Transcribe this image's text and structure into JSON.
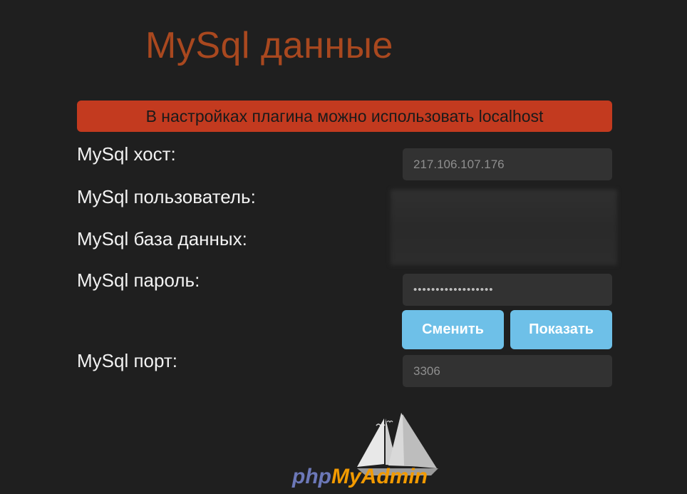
{
  "page": {
    "title": "MySql данные",
    "notice": "В настройках плагина можно использовать localhost"
  },
  "fields": {
    "host": {
      "label": "MySql хост:",
      "value": "217.106.107.176"
    },
    "user": {
      "label": "MySql пользователь:"
    },
    "database": {
      "label": "MySql база данных:"
    },
    "password": {
      "label": "MySql пароль:",
      "value": "••••••••••••••••••"
    },
    "port": {
      "label": "MySql порт:",
      "value": "3306"
    }
  },
  "buttons": {
    "change": "Сменить",
    "show": "Показать"
  },
  "logo": {
    "php": "php",
    "myadmin": "MyAdmin"
  },
  "colors": {
    "background": "#1f1f1f",
    "title": "#a9481f",
    "notice": "#c33a1f",
    "button": "#6ec0e8",
    "field": "#323232"
  }
}
